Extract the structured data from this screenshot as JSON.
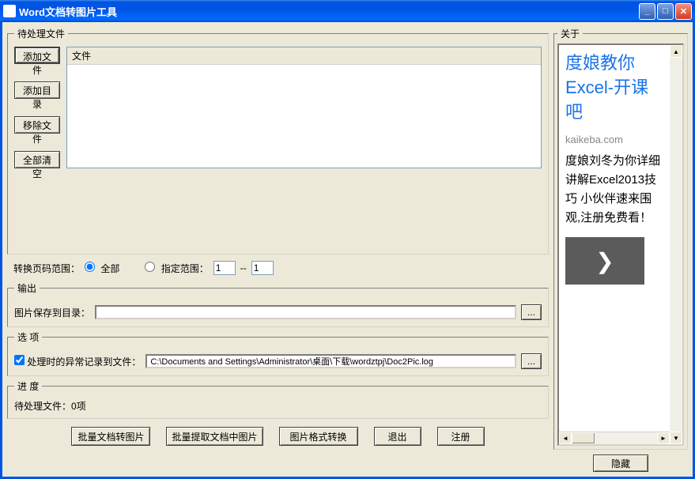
{
  "window": {
    "title": "Word文档转图片工具"
  },
  "groups": {
    "pending": "待处理文件",
    "output": "输出",
    "options": "选 项",
    "progress": "进 度",
    "about": "关于"
  },
  "buttons": {
    "add_file": "添加文件",
    "add_dir": "添加目录",
    "remove_file": "移除文件",
    "clear_all": "全部清空",
    "browse": "...",
    "batch_convert": "批量文档转图片",
    "batch_extract": "批量提取文档中图片",
    "format_convert": "图片格式转换",
    "exit": "退出",
    "register": "注册",
    "hide": "隐藏"
  },
  "list": {
    "header_file": "文件"
  },
  "page_range": {
    "label": "转换页码范围：",
    "all": "全部",
    "range": "指定范围：",
    "from": "1",
    "to": "1",
    "sep": "--"
  },
  "output": {
    "save_dir_label": "图片保存到目录：",
    "save_dir_value": ""
  },
  "options": {
    "log_checkbox_label": "处理时的异常记录到文件：",
    "log_path": "C:\\Documents and Settings\\Administrator\\桌面\\下载\\wordztpj\\Doc2Pic.log"
  },
  "progress": {
    "pending_label": "待处理文件：",
    "pending_count": "0项"
  },
  "about": {
    "ad_title": "度娘教你Excel-开课吧",
    "ad_domain": "kaikeba.com",
    "ad_body": "度娘刘冬为你详细讲解Excel2013技巧 小伙伴速来围观,注册免费看！",
    "arrow": "❯"
  }
}
